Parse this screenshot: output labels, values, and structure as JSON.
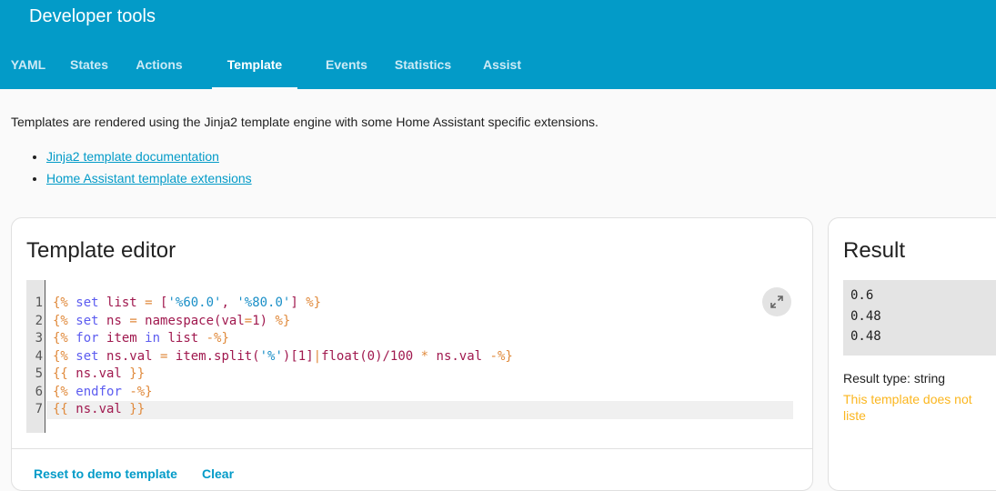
{
  "header": {
    "title": "Developer tools",
    "tabs": [
      {
        "label": "YAML"
      },
      {
        "label": "States"
      },
      {
        "label": "Actions"
      },
      {
        "label": "Template",
        "active": true
      },
      {
        "label": "Events"
      },
      {
        "label": "Statistics"
      },
      {
        "label": "Assist"
      }
    ]
  },
  "intro": {
    "text": "Templates are rendered using the Jinja2 template engine with some Home Assistant specific extensions.",
    "links": [
      {
        "label": "Jinja2 template documentation"
      },
      {
        "label": "Home Assistant template extensions"
      }
    ]
  },
  "editor": {
    "title": "Template editor",
    "expand_icon": "arrow-expand-icon",
    "lines": [
      [
        [
          "br",
          "{%"
        ],
        [
          "pl",
          " "
        ],
        [
          "kw",
          "set"
        ],
        [
          "pl",
          " list "
        ],
        [
          "op",
          "="
        ],
        [
          "pl",
          " ["
        ],
        [
          "str",
          "'%60.0'"
        ],
        [
          "pl",
          ", "
        ],
        [
          "str",
          "'%80.0'"
        ],
        [
          "pl",
          "] "
        ],
        [
          "br",
          "%}"
        ]
      ],
      [
        [
          "br",
          "{%"
        ],
        [
          "pl",
          " "
        ],
        [
          "kw",
          "set"
        ],
        [
          "pl",
          " ns "
        ],
        [
          "op",
          "="
        ],
        [
          "pl",
          " namespace(val"
        ],
        [
          "op",
          "="
        ],
        [
          "pl",
          "1) "
        ],
        [
          "br",
          "%}"
        ]
      ],
      [
        [
          "br",
          "{%"
        ],
        [
          "pl",
          " "
        ],
        [
          "kw",
          "for"
        ],
        [
          "pl",
          " item "
        ],
        [
          "kw",
          "in"
        ],
        [
          "pl",
          " list "
        ],
        [
          "br",
          "-%}"
        ]
      ],
      [
        [
          "br",
          "{%"
        ],
        [
          "pl",
          " "
        ],
        [
          "kw",
          "set"
        ],
        [
          "pl",
          " ns.val "
        ],
        [
          "op",
          "="
        ],
        [
          "pl",
          " item.split("
        ],
        [
          "str",
          "'%'"
        ],
        [
          "pl",
          ")[1]"
        ],
        [
          "op",
          "|"
        ],
        [
          "pl",
          "float(0)/100 "
        ],
        [
          "op",
          "*"
        ],
        [
          "pl",
          " ns.val "
        ],
        [
          "br",
          "-%}"
        ]
      ],
      [
        [
          "br",
          "{{"
        ],
        [
          "pl",
          " ns.val "
        ],
        [
          "br",
          "}}"
        ]
      ],
      [
        [
          "br",
          "{%"
        ],
        [
          "pl",
          " "
        ],
        [
          "kw",
          "endfor"
        ],
        [
          "pl",
          " "
        ],
        [
          "br",
          "-%}"
        ]
      ],
      [
        [
          "br",
          "{{"
        ],
        [
          "pl",
          " ns.val "
        ],
        [
          "br",
          "}}"
        ]
      ]
    ],
    "reset_label": "Reset to demo template",
    "clear_label": "Clear"
  },
  "result": {
    "title": "Result",
    "lines": [
      "0.6",
      "0.48",
      "0.48"
    ],
    "type_text": "Result type: string",
    "warning": "This template does not liste"
  }
}
